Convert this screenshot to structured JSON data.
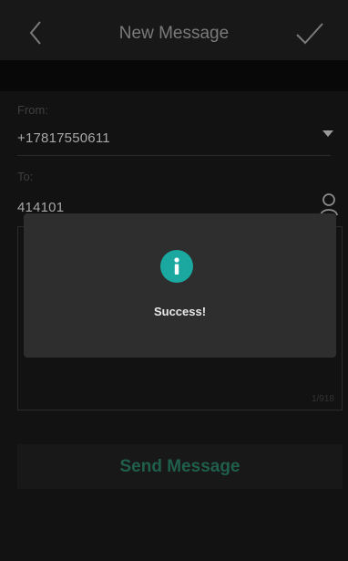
{
  "header": {
    "title": "New Message",
    "back_icon": "chevron-left-icon",
    "confirm_icon": "checkmark-icon"
  },
  "form": {
    "from_label": "From:",
    "from_value": "+17817550611",
    "to_label": "To:",
    "to_value": "414101",
    "char_count": "1/918"
  },
  "send_button": {
    "label": "Send Message"
  },
  "toast": {
    "icon": "info-icon",
    "message": "Success!"
  },
  "colors": {
    "accent": "#1aa8a0",
    "send_text": "#1f5f4c",
    "background": "#121212"
  }
}
